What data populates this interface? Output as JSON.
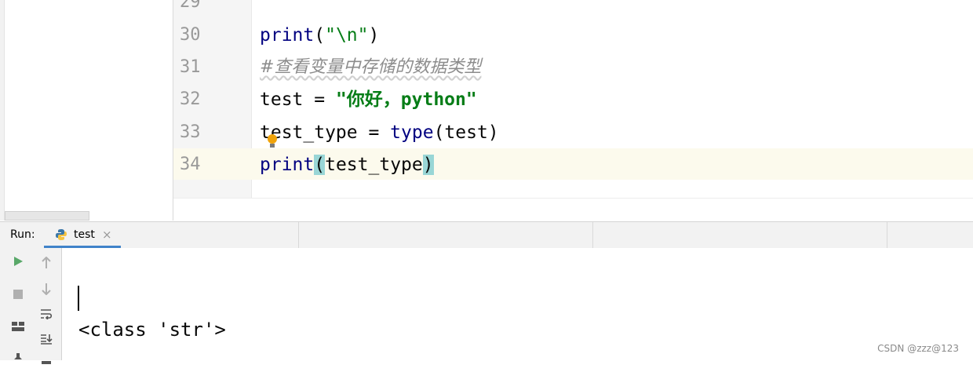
{
  "editor": {
    "lines": [
      {
        "num": "29"
      },
      {
        "num": "30"
      },
      {
        "num": "31"
      },
      {
        "num": "32"
      },
      {
        "num": "33"
      },
      {
        "num": "34"
      }
    ],
    "code": {
      "l30_fn": "print",
      "l30_open": "(",
      "l30_str": "\"\\n\"",
      "l30_close": ")",
      "l31_comment": "#查看变量中存储的数据类型",
      "l32_var": "test = ",
      "l32_str": "\"你好，python\"",
      "l33_var": "test_type = ",
      "l33_fn": "type",
      "l33_args": "(test)",
      "l34_fn": "print",
      "l34_open": "(",
      "l34_arg": "test_type",
      "l34_close": ")"
    }
  },
  "run_panel": {
    "label": "Run:",
    "tab_label": "test",
    "tab_close": "×"
  },
  "console": {
    "output": "<class 'str'>"
  },
  "watermark": "CSDN @zzz@123",
  "colors": {
    "accent": "#4083c9",
    "run_green": "#59a869",
    "current_line": "#fcfaed",
    "brace_highlight": "#99d6d6"
  }
}
